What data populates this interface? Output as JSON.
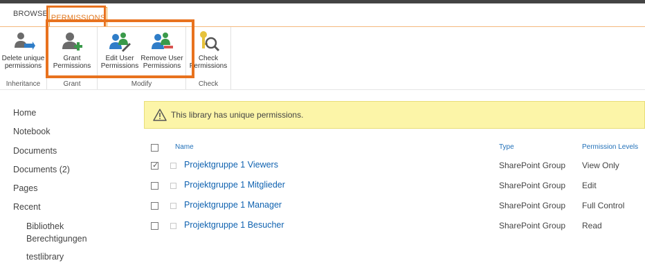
{
  "tabs": {
    "browse": "BROWSE",
    "permissions": "PERMISSIONS"
  },
  "ribbon": {
    "inheritance": {
      "button": [
        "Delete unique",
        "permissions"
      ],
      "label": "Inheritance"
    },
    "grant": {
      "button": [
        "Grant",
        "Permissions"
      ],
      "label": "Grant"
    },
    "modify": {
      "edit": [
        "Edit User",
        "Permissions"
      ],
      "remove": [
        "Remove User",
        "Permissions"
      ],
      "label": "Modify"
    },
    "check": {
      "button": [
        "Check",
        "Permissions"
      ],
      "label": "Check"
    }
  },
  "nav": {
    "items": [
      "Home",
      "Notebook",
      "Documents",
      "Documents (2)",
      "Pages",
      "Recent"
    ],
    "recent_sub": [
      "Bibliothek Berechtigungen",
      "testlibrary"
    ]
  },
  "banner": {
    "text": "This library has unique permissions."
  },
  "table": {
    "headers": {
      "name": "Name",
      "type": "Type",
      "levels": "Permission Levels"
    },
    "rows": [
      {
        "name": "Projektgruppe  1 Viewers",
        "type": "SharePoint Group",
        "level": "View Only",
        "checked": true
      },
      {
        "name": "Projektgruppe  1 Mitglieder",
        "type": "SharePoint Group",
        "level": "Edit",
        "checked": false
      },
      {
        "name": "Projektgruppe  1 Manager",
        "type": "SharePoint Group",
        "level": "Full Control",
        "checked": false
      },
      {
        "name": "Projektgruppe  1 Besucher",
        "type": "SharePoint Group",
        "level": "Read",
        "checked": false
      }
    ]
  },
  "colors": {
    "accent": "#e8721e",
    "link": "#0f62b0",
    "banner": "#fcf5a8"
  }
}
